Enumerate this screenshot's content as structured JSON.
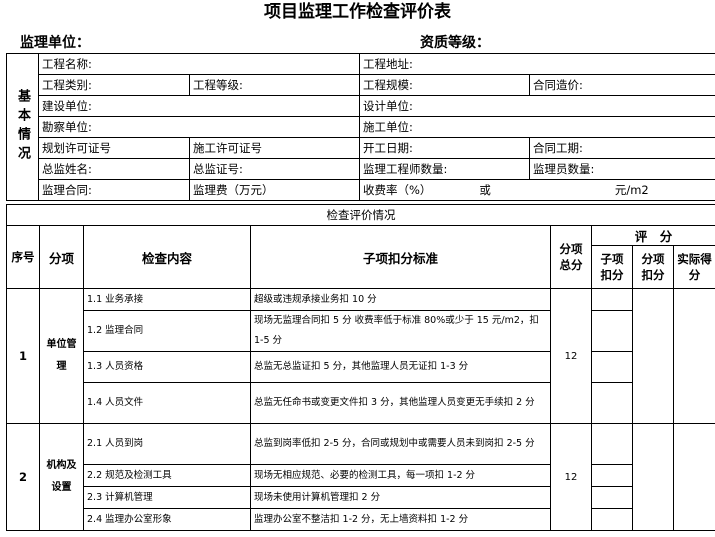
{
  "title": "项目监理工作检查评价表",
  "header": {
    "unit_label": "监理单位：",
    "grade_label": "资质等级："
  },
  "basic": {
    "side_label": "基本情况",
    "project_name": "工程名称:",
    "project_address": "工程地址:",
    "project_category": "工程类别:",
    "project_level": "工程等级:",
    "project_scale": "工程规模:",
    "contract_price": "合同造价:",
    "owner_unit": "建设单位:",
    "design_unit": "设计单位:",
    "survey_unit": "勘察单位:",
    "construction_unit": "施工单位:",
    "planning_permit": "规划许可证号",
    "construction_permit": "施工许可证号",
    "start_date": "开工日期:",
    "contract_period": "合同工期:",
    "chief_name": "总监姓名:",
    "chief_cert": "总监证号:",
    "engineer_count": "监理工程师数量:",
    "staff_count": "监理员数量:",
    "contract": "监理合同:",
    "fee": "监理费（万元）",
    "fee_rate": "收费率（%）",
    "or": "或",
    "unit": "元/m2"
  },
  "eval": {
    "section_title": "检查评价情况",
    "headers": {
      "seq": "序号",
      "category": "分项",
      "content": "检查内容",
      "standard": "子项扣分标准",
      "total": "分项总分",
      "score": "评　分",
      "sub_deduct": "子项扣分",
      "cat_deduct": "分项扣分",
      "actual": "实际得分"
    },
    "groups": [
      {
        "seq": "1",
        "category": "单位管理",
        "total": "12",
        "items": [
          {
            "content": "1.1 业务承接",
            "standard": "超级或违规承接业务扣 10 分"
          },
          {
            "content": "1.2 监理合同",
            "standard": "现场无监理合同扣 5 分 收费率低于标准 80%或少于 15 元/m2，扣 1-5 分"
          },
          {
            "content": "1.3 人员资格",
            "standard": "总监无总监证扣 5 分，其他监理人员无证扣 1-3 分"
          },
          {
            "content": "1.4 人员文件",
            "standard": "总监无任命书或变更文件扣 3 分，其他监理人员变更无手续扣 2 分"
          }
        ]
      },
      {
        "seq": "2",
        "category": "机构及设置",
        "total": "12",
        "items": [
          {
            "content": "2.1 人员到岗",
            "standard": "总监到岗率低扣 2-5 分，合同或规划中或需要人员未到岗扣 2-5 分"
          },
          {
            "content": "2.2 规范及检测工具",
            "standard": "现场无相应规范、必要的检测工具，每一项扣 1-2 分"
          },
          {
            "content": "2.3 计算机管理",
            "standard": "现场未使用计算机管理扣 2 分"
          },
          {
            "content": "2.4 监理办公室形象",
            "standard": "监理办公室不整洁扣 1-2 分，无上墙资料扣 1-2 分"
          }
        ]
      }
    ]
  }
}
